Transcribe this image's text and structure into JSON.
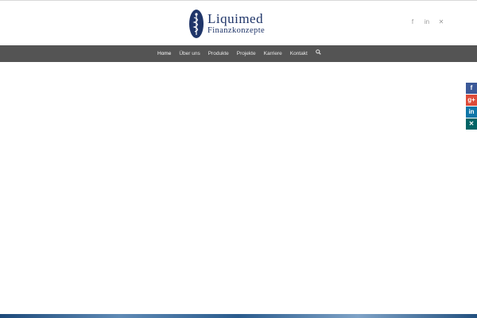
{
  "brand": {
    "name": "Liquimed",
    "subtitle": "Finanzkonzepte",
    "color": "#1f3569"
  },
  "header": {
    "social": [
      {
        "icon": "facebook-icon",
        "glyph": "f"
      },
      {
        "icon": "linkedin-icon",
        "glyph": "in"
      },
      {
        "icon": "xing-icon",
        "glyph": "✕"
      }
    ]
  },
  "nav": {
    "background": "#545454",
    "items": [
      {
        "label": "Home",
        "active": true
      },
      {
        "label": "Über uns"
      },
      {
        "label": "Produkte"
      },
      {
        "label": "Projekte"
      },
      {
        "label": "Karriere"
      },
      {
        "label": "Kontakt"
      }
    ],
    "search_icon": "search-icon"
  },
  "share_bar": [
    {
      "icon": "facebook-icon",
      "glyph": "f",
      "color": "#3b5998"
    },
    {
      "icon": "google-plus-icon",
      "glyph": "g+",
      "color": "#dd4b39"
    },
    {
      "icon": "linkedin-icon",
      "glyph": "in",
      "color": "#0e76a8"
    },
    {
      "icon": "xing-icon",
      "glyph": "✕",
      "color": "#026466"
    }
  ]
}
